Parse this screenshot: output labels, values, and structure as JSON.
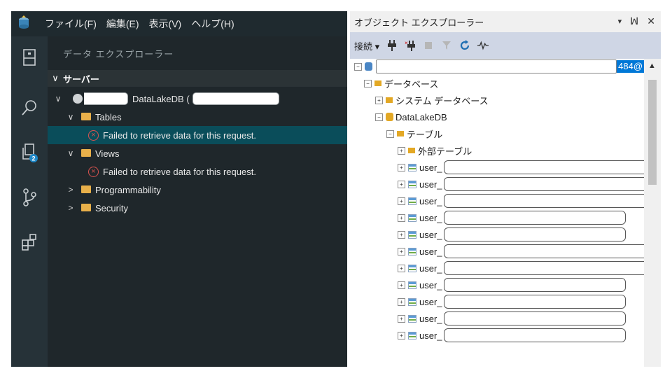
{
  "ads": {
    "menu": [
      "ファイル(F)",
      "編集(E)",
      "表示(V)",
      "ヘルプ(H)"
    ],
    "sidebar_title": "データ エクスプローラー",
    "servers_header": "サーバー",
    "badge": "2",
    "tree": {
      "server_label": "DataLakeDB (",
      "tables_label": "Tables",
      "tables_error": "Failed to retrieve data for this request.",
      "views_label": "Views",
      "views_error": "Failed to retrieve data for this request.",
      "programmability_label": "Programmability",
      "security_label": "Security"
    }
  },
  "object_explorer": {
    "title": "オブジェクト エクスプローラー",
    "title_controls": [
      "▾",
      "ꟽ",
      "✕"
    ],
    "toolbar_connect": "接続 ▾",
    "root_suffix": "484@",
    "nodes": {
      "databases": "データベース",
      "system_databases": "システム データベース",
      "datalakedb": "DataLakeDB",
      "tables": "テーブル",
      "external_tables": "外部テーブル",
      "table_prefix": "user_"
    },
    "table_count": 11
  },
  "colors": {
    "ads_selection": "#0a4d5a",
    "error_red": "#d9534f",
    "folder_yellow": "#e8b04a",
    "oe_toolbar": "#cfd6e5"
  }
}
